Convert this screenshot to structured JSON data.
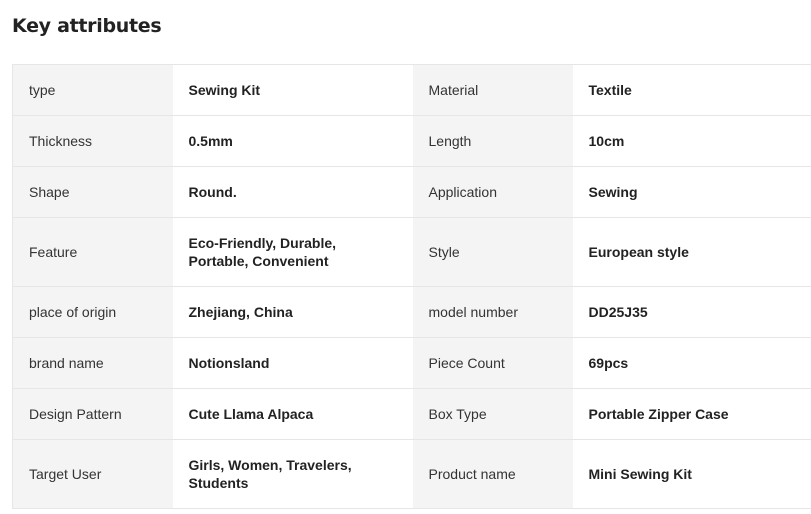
{
  "section": {
    "title": "Key attributes"
  },
  "attributes": [
    {
      "label": "type",
      "value": "Sewing Kit"
    },
    {
      "label": "Material",
      "value": "Textile"
    },
    {
      "label": "Thickness",
      "value": "0.5mm"
    },
    {
      "label": "Length",
      "value": "10cm"
    },
    {
      "label": "Shape",
      "value": "Round."
    },
    {
      "label": "Application",
      "value": "Sewing"
    },
    {
      "label": "Feature",
      "value": "Eco-Friendly, Durable, Portable, Convenient"
    },
    {
      "label": "Style",
      "value": "European style"
    },
    {
      "label": "place of origin",
      "value": "Zhejiang, China"
    },
    {
      "label": "model number",
      "value": "DD25J35"
    },
    {
      "label": "brand name",
      "value": "Notionsland"
    },
    {
      "label": "Piece Count",
      "value": "69pcs"
    },
    {
      "label": "Design Pattern",
      "value": "Cute Llama Alpaca"
    },
    {
      "label": "Box Type",
      "value": "Portable Zipper Case"
    },
    {
      "label": "Target User",
      "value": "Girls, Women, Travelers, Students"
    },
    {
      "label": "Product name",
      "value": "Mini Sewing Kit"
    }
  ],
  "colors": {
    "key_cell_bg": "#f4f4f4",
    "value_cell_bg": "#ffffff",
    "border": "#e6e6e6",
    "text": "#222222"
  }
}
